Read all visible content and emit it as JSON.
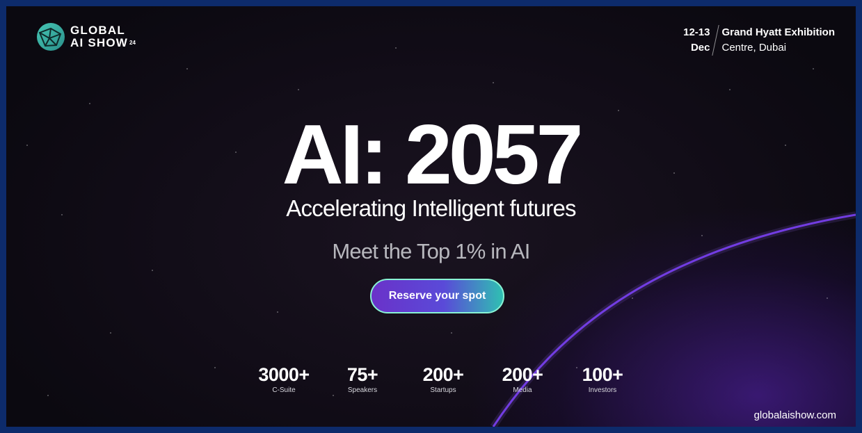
{
  "logo": {
    "line1": "GLOBAL",
    "line2": "AI SHOW",
    "edition": "24"
  },
  "event": {
    "dates": "12-13",
    "month": "Dec",
    "venue_line1": "Grand Hyatt Exhibition",
    "venue_line2": "Centre, Dubai"
  },
  "hero": {
    "headline": "AI: 2057",
    "subhead": "Accelerating Intelligent futures",
    "tagline": "Meet the Top 1% in AI",
    "cta": "Reserve your spot"
  },
  "stats": [
    {
      "value": "3000+",
      "label": "C-Suite"
    },
    {
      "value": "75+",
      "label": "Speakers"
    },
    {
      "value": "200+",
      "label": "Startups"
    },
    {
      "value": "200+",
      "label": "Media"
    },
    {
      "value": "100+",
      "label": "Investors"
    }
  ],
  "website": "globalaishow.com",
  "colors": {
    "border": "#0d2b6b",
    "accent_purple": "#6a32c9",
    "accent_teal": "#2fc0b2",
    "logo_teal": "#46c6b4"
  }
}
